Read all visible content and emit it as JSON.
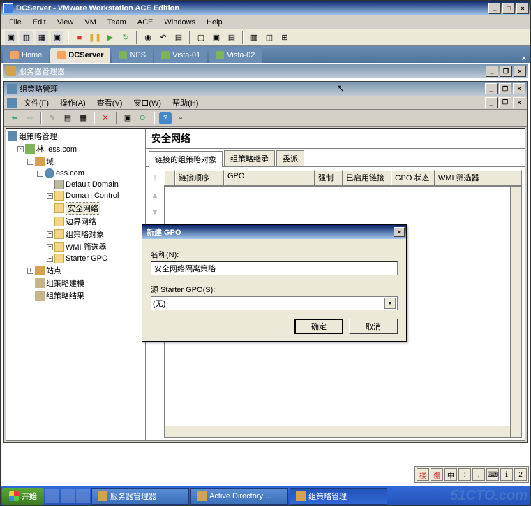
{
  "vmware": {
    "title": "DCServer - VMware Workstation ACE Edition",
    "menus": [
      "File",
      "Edit",
      "View",
      "VM",
      "Team",
      "ACE",
      "Windows",
      "Help"
    ],
    "tabs": [
      {
        "label": "Home",
        "active": false
      },
      {
        "label": "DCServer",
        "active": true
      },
      {
        "label": "NPS",
        "active": false
      },
      {
        "label": "Vista-01",
        "active": false
      },
      {
        "label": "Vista-02",
        "active": false
      }
    ]
  },
  "server_mgr": {
    "title": "服务器管理器"
  },
  "gpm": {
    "title": "组策略管理",
    "menus": [
      "文件(F)",
      "操作(A)",
      "查看(V)",
      "窗口(W)",
      "帮助(H)"
    ],
    "tree": {
      "root": "组策略管理",
      "forest": "林: ess.com",
      "domains": "域",
      "domain": "ess.com",
      "items": [
        "Default Domain",
        "Domain Control",
        "安全网络",
        "边界网络",
        "组策略对象",
        "WMI 筛选器",
        "Starter GPO"
      ],
      "sites": "站点",
      "modeling": "组策略建模",
      "results": "组策略结果"
    },
    "detail": {
      "heading": "安全网络",
      "tabs": [
        "链接的组策略对象",
        "组策略继承",
        "委派"
      ],
      "columns": [
        "链接顺序",
        "GPO",
        "强制",
        "已启用链接",
        "GPO 状态",
        "WMI 筛选器"
      ]
    }
  },
  "dialog": {
    "title": "新建 GPO",
    "name_label": "名称(N):",
    "name_value": "安全网络隔离策略",
    "source_label": "源 Starter GPO(S):",
    "source_value": "(无)",
    "ok": "确定",
    "cancel": "取消"
  },
  "taskbar": {
    "start": "开始",
    "tasks": [
      {
        "label": "服务器管理器"
      },
      {
        "label": "Active Directory ..."
      },
      {
        "label": "组策略管理",
        "active": true
      }
    ]
  },
  "ime": [
    "楼",
    "傷",
    "中",
    ":",
    ",",
    "",
    "",
    "2"
  ],
  "watermark": "51CTO.com"
}
